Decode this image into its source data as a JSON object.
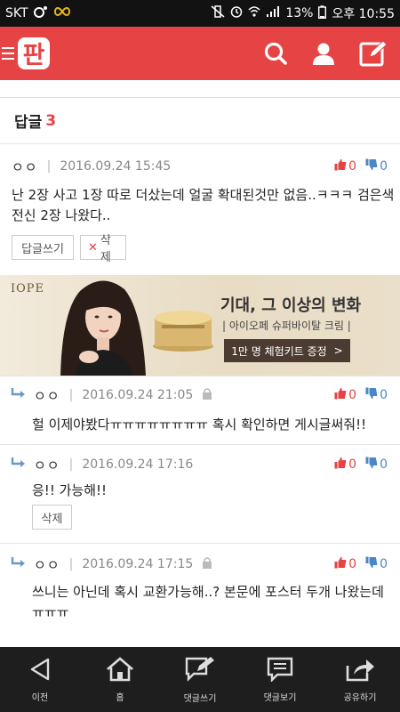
{
  "status_bar": {
    "carrier": "SKT",
    "battery": "13%",
    "time": "오후 10:55"
  },
  "app_bar": {
    "logo_text": "판"
  },
  "reply_header": {
    "label": "답글",
    "count": "3"
  },
  "comments": [
    {
      "author": "ㅇㅇ",
      "date": "2016.09.24 15:45",
      "likes": "0",
      "dislikes": "0",
      "text_line1": "난 2장 사고 1장 따로 더샀는데 얼굴 확대된것만 없음..ㅋㅋㅋ 검은색",
      "text_line2": "전신 2장 나왔다..",
      "reply_btn": "답글쓰기",
      "delete_btn": "삭제"
    },
    {
      "author": "ㅇㅇ",
      "date": "2016.09.24 21:05",
      "likes": "0",
      "dislikes": "0",
      "text": "헐 이제야봤다ㅠㅠㅠㅠㅠㅠㅠㅠ 혹시 확인하면 게시글써줘!!"
    },
    {
      "author": "ㅇㅇ",
      "date": "2016.09.24 17:16",
      "likes": "0",
      "dislikes": "0",
      "text": "응!! 가능해!!",
      "delete_btn": "삭제"
    },
    {
      "author": "ㅇㅇ",
      "date": "2016.09.24 17:15",
      "likes": "0",
      "dislikes": "0",
      "text_line1": "쓰니는 아닌데 혹시 교환가능해..? 본문에 포스터 두개 나왔는데",
      "text_line2": "ㅠㅠㅠ"
    }
  ],
  "ad": {
    "brand": "IOPE",
    "headline": "기대, 그 이상의 변화",
    "subline": "| 아이오페 슈퍼바이탈 크림 |",
    "cta": "1만 명 체험키트 증정",
    "cta_arrow": ">"
  },
  "bottom_nav": {
    "back": "이전",
    "home": "홈",
    "write_comment": "댓글쓰기",
    "view_comments": "댓글보기",
    "share": "공유하기"
  },
  "colors": {
    "brand_red": "#e64344",
    "nav_bg": "#1e1e1e",
    "dislike_blue": "#4a87c7"
  }
}
